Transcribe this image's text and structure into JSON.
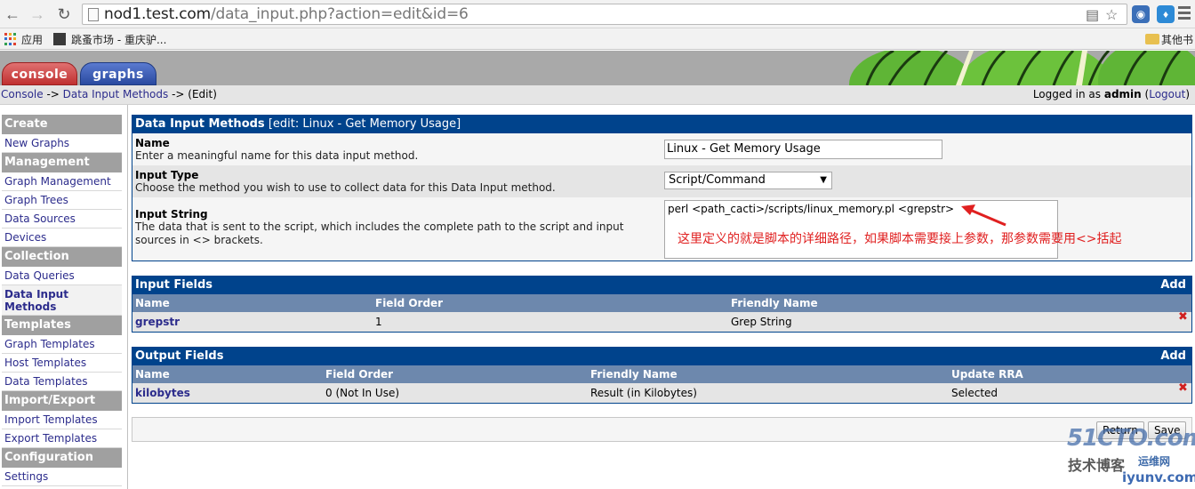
{
  "browser": {
    "url_host": "nod1.test.com",
    "url_path": "/data_input.php?action=edit&id=6",
    "bookmarks": [
      "应用",
      "跳蚤市场 - 重庆驴...",
      "其他书"
    ]
  },
  "tabs": {
    "console": "console",
    "graphs": "graphs"
  },
  "breadcrumb": {
    "console": "Console",
    "sep1": " -> ",
    "data_input_methods": "Data Input Methods",
    "sep2": " -> ",
    "current": "(Edit)"
  },
  "login": {
    "prefix": "Logged in as ",
    "user": "admin",
    "open_paren": " (",
    "logout": "Logout",
    "close_paren": ")"
  },
  "sidebar": {
    "sections": [
      {
        "header": "Create",
        "items": [
          "New Graphs"
        ]
      },
      {
        "header": "Management",
        "items": [
          "Graph Management",
          "Graph Trees",
          "Data Sources",
          "Devices"
        ]
      },
      {
        "header": "Collection Methods",
        "items": [
          "Data Queries",
          "Data Input Methods"
        ]
      },
      {
        "header": "Templates",
        "items": [
          "Graph Templates",
          "Host Templates",
          "Data Templates"
        ]
      },
      {
        "header": "Import/Export",
        "items": [
          "Import Templates",
          "Export Templates"
        ]
      },
      {
        "header": "Configuration",
        "items": [
          "Settings"
        ]
      }
    ],
    "active_item": "Data Input Methods"
  },
  "edit_panel": {
    "title": "Data Input Methods",
    "subtitle": "[edit: Linux - Get Memory Usage]",
    "name": {
      "label": "Name",
      "desc": "Enter a meaningful name for this data input method.",
      "value": "Linux - Get Memory Usage"
    },
    "input_type": {
      "label": "Input Type",
      "desc": "Choose the method you wish to use to collect data for this Data Input method.",
      "value": "Script/Command"
    },
    "input_string": {
      "label": "Input String",
      "desc1": "The data that is sent to the script, which includes the complete path to the script and input",
      "desc2": "sources in <> brackets.",
      "value": "perl <path_cacti>/scripts/linux_memory.pl <grepstr>"
    },
    "annotation": "这里定义的就是脚本的详细路径，如果脚本需要接上参数，那参数需要用<>括起"
  },
  "input_fields": {
    "title": "Input Fields",
    "add": "Add",
    "columns": [
      "Name",
      "Field Order",
      "Friendly Name"
    ],
    "rows": [
      {
        "name": "grepstr",
        "order": "1",
        "friendly": "Grep String"
      }
    ]
  },
  "output_fields": {
    "title": "Output Fields",
    "add": "Add",
    "columns": [
      "Name",
      "Field Order",
      "Friendly Name",
      "Update RRA"
    ],
    "rows": [
      {
        "name": "kilobytes",
        "order": "0 (Not In Use)",
        "friendly": "Result (in Kilobytes)",
        "rra": "Selected"
      }
    ]
  },
  "buttons": {
    "return": "Return",
    "save": "Save"
  },
  "watermark": {
    "line1": "51CTO.com",
    "line2": "技术博客",
    "line3": "运维网",
    "line4": "iyunv.com"
  },
  "colors": {
    "panel_blue": "#00438c",
    "column_header": "#6d88ad",
    "menu_header": "#a0a0a0",
    "annotation_red": "#e02020"
  }
}
